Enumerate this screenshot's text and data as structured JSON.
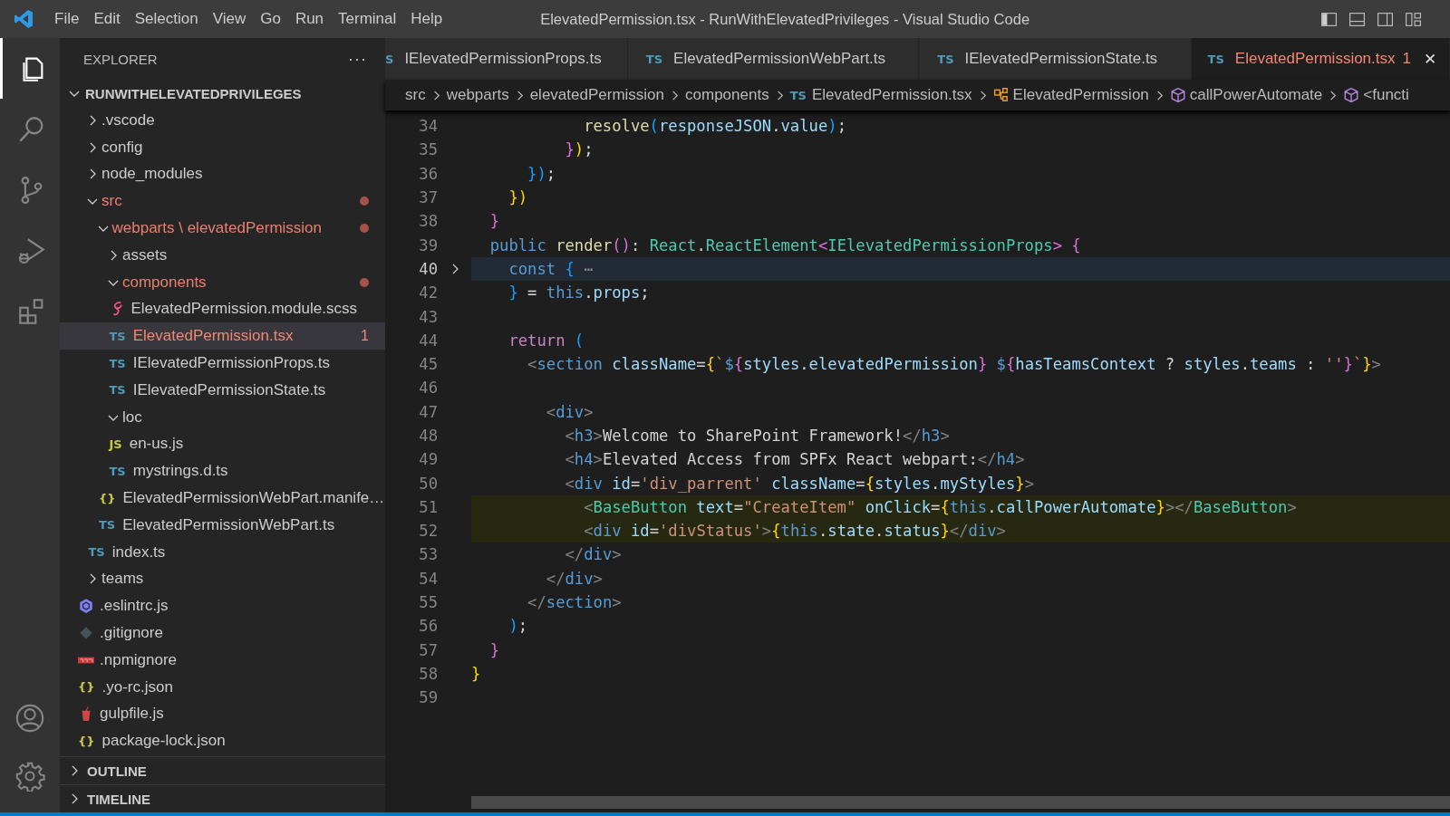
{
  "title_bar": {
    "menu": [
      "File",
      "Edit",
      "Selection",
      "View",
      "Go",
      "Run",
      "Terminal",
      "Help"
    ],
    "title": "ElevatedPermission.tsx - RunWithElevatedPrivileges - Visual Studio Code",
    "layout_buttons": [
      {
        "kind": "sidebar"
      },
      {
        "kind": "panel"
      },
      {
        "kind": "secondary"
      },
      {
        "kind": "customize"
      }
    ]
  },
  "activity_bar": {
    "items": [
      {
        "kind": "explorer",
        "selected": true
      },
      {
        "kind": "search",
        "selected": false
      },
      {
        "kind": "scm",
        "selected": false
      },
      {
        "kind": "debug",
        "selected": false
      },
      {
        "kind": "extensions",
        "selected": false
      }
    ],
    "bottom": [
      {
        "kind": "account"
      },
      {
        "kind": "settings"
      }
    ]
  },
  "explorer": {
    "title": "EXPLORER",
    "more": "···",
    "project": {
      "label": "RUNWITHELEVATEDPRIVILEGES",
      "expanded": true,
      "children": [
        {
          "kind": "folder",
          "label": ".vscode",
          "expanded": false,
          "selected": false,
          "modified": false,
          "error": false
        },
        {
          "kind": "folder",
          "label": "config",
          "expanded": false,
          "selected": false,
          "modified": false,
          "error": false
        },
        {
          "kind": "folder",
          "label": "node_modules",
          "expanded": false,
          "selected": false,
          "modified": false,
          "error": false
        },
        {
          "kind": "folder",
          "label": "src",
          "expanded": true,
          "selected": false,
          "modified": true,
          "error": false,
          "children": [
            {
              "kind": "folder",
              "label": "webparts \\ elevatedPermission",
              "expanded": true,
              "selected": false,
              "modified": true,
              "error": false,
              "children": [
                {
                  "kind": "folder",
                  "label": "assets",
                  "expanded": false,
                  "selected": false,
                  "modified": false,
                  "error": false
                },
                {
                  "kind": "folder",
                  "label": "components",
                  "expanded": true,
                  "selected": false,
                  "modified": true,
                  "error": false,
                  "children": [
                    {
                      "kind": "scss",
                      "label": "ElevatedPermission.module.scss",
                      "selected": false,
                      "modified": false,
                      "error": false
                    },
                    {
                      "kind": "ts",
                      "glyph": "TS",
                      "label": "ElevatedPermission.tsx",
                      "selected": true,
                      "modified": false,
                      "error": true,
                      "problems": "1"
                    },
                    {
                      "kind": "ts",
                      "glyph": "TS",
                      "label": "IElevatedPermissionProps.ts",
                      "selected": false,
                      "modified": false,
                      "error": false
                    },
                    {
                      "kind": "ts",
                      "glyph": "TS",
                      "label": "IElevatedPermissionState.ts",
                      "selected": false,
                      "modified": false,
                      "error": false
                    }
                  ]
                },
                {
                  "kind": "folder",
                  "label": "loc",
                  "expanded": true,
                  "selected": false,
                  "modified": false,
                  "error": false,
                  "children": [
                    {
                      "kind": "js",
                      "glyph": "JS",
                      "label": "en-us.js",
                      "selected": false,
                      "modified": false,
                      "error": false
                    },
                    {
                      "kind": "ts",
                      "glyph": "TS",
                      "label": "mystrings.d.ts",
                      "selected": false,
                      "modified": false,
                      "error": false
                    }
                  ]
                },
                {
                  "kind": "json",
                  "glyph": "{}",
                  "label": "ElevatedPermissionWebPart.manife…",
                  "selected": false,
                  "modified": false,
                  "error": false
                },
                {
                  "kind": "ts",
                  "glyph": "TS",
                  "label": "ElevatedPermissionWebPart.ts",
                  "selected": false,
                  "modified": false,
                  "error": false
                }
              ]
            },
            {
              "kind": "ts",
              "glyph": "TS",
              "label": "index.ts",
              "selected": false,
              "modified": false,
              "error": false
            }
          ]
        },
        {
          "kind": "folder",
          "label": "teams",
          "expanded": false,
          "selected": false,
          "modified": false,
          "error": false
        },
        {
          "kind": "eslint",
          "label": ".eslintrc.js",
          "selected": false,
          "modified": false,
          "error": false
        },
        {
          "kind": "git",
          "label": ".gitignore",
          "selected": false,
          "modified": false,
          "error": false
        },
        {
          "kind": "npm",
          "label": ".npmignore",
          "selected": false,
          "modified": false,
          "error": false
        },
        {
          "kind": "json",
          "glyph": "{}",
          "label": ".yo-rc.json",
          "selected": false,
          "modified": false,
          "error": false
        },
        {
          "kind": "gulp",
          "label": "gulpfile.js",
          "selected": false,
          "modified": false,
          "error": false
        },
        {
          "kind": "json",
          "glyph": "{}",
          "label": "package-lock.json",
          "selected": false,
          "modified": false,
          "error": false
        }
      ]
    },
    "sections": [
      {
        "label": "OUTLINE",
        "expanded": false
      },
      {
        "label": "TIMELINE",
        "expanded": false
      }
    ]
  },
  "tabs": [
    {
      "glyph": "S",
      "label": "IElevatedPermissionProps.ts",
      "selected": false,
      "error": false
    },
    {
      "glyph": "TS",
      "label": "ElevatedPermissionWebPart.ts",
      "selected": false,
      "error": false
    },
    {
      "glyph": "TS",
      "label": "IElevatedPermissionState.ts",
      "selected": false,
      "error": false
    },
    {
      "glyph": "TS",
      "label": "ElevatedPermission.tsx",
      "selected": true,
      "error": true,
      "problems": "1",
      "close": "✕"
    }
  ],
  "breadcrumbs": [
    {
      "kind": "folder",
      "label": "src"
    },
    {
      "kind": "folder",
      "label": "webparts"
    },
    {
      "kind": "folder",
      "label": "elevatedPermission"
    },
    {
      "kind": "folder",
      "label": "components"
    },
    {
      "kind": "file",
      "glyph": "TS",
      "label": "ElevatedPermission.tsx"
    },
    {
      "kind": "class",
      "label": "ElevatedPermission"
    },
    {
      "kind": "method",
      "label": "callPowerAutomate"
    },
    {
      "kind": "method",
      "label": "<functi"
    }
  ],
  "code": [
    {
      "n": "34",
      "fold": false,
      "current": false,
      "hl": false,
      "tokens": [
        {
          "t": "            resolve",
          "kind": "fn"
        },
        {
          "t": "(",
          "kind": "b3"
        },
        {
          "t": "responseJSON",
          "kind": "var"
        },
        {
          "t": ".",
          "kind": "plain"
        },
        {
          "t": "value",
          "kind": "var"
        },
        {
          "t": ")",
          "kind": "b3"
        },
        {
          "t": ";",
          "kind": "plain"
        }
      ]
    },
    {
      "n": "35",
      "fold": false,
      "current": false,
      "hl": false,
      "tokens": [
        {
          "t": "          }",
          "kind": "b2"
        },
        {
          "t": ")",
          "kind": "b1"
        },
        {
          "t": ";",
          "kind": "plain"
        }
      ]
    },
    {
      "n": "36",
      "fold": false,
      "current": false,
      "hl": false,
      "tokens": [
        {
          "t": "      })",
          "kind": "b3"
        },
        {
          "t": ";",
          "kind": "plain"
        }
      ]
    },
    {
      "n": "37",
      "fold": false,
      "current": false,
      "hl": false,
      "tokens": [
        {
          "t": "    })",
          "kind": "b1"
        }
      ]
    },
    {
      "n": "38",
      "fold": false,
      "current": false,
      "hl": false,
      "tokens": [
        {
          "t": "  }",
          "kind": "b2"
        }
      ]
    },
    {
      "n": "39",
      "fold": false,
      "current": false,
      "hl": false,
      "tokens": [
        {
          "t": "  public",
          "kind": "kw"
        },
        {
          "t": " render",
          "kind": "fn"
        },
        {
          "t": "()",
          "kind": "b2"
        },
        {
          "t": ": ",
          "kind": "plain"
        },
        {
          "t": "React",
          "kind": "type"
        },
        {
          "t": ".",
          "kind": "plain"
        },
        {
          "t": "ReactElement",
          "kind": "type"
        },
        {
          "t": "<",
          "kind": "b2"
        },
        {
          "t": "IElevatedPermissionProps",
          "kind": "type"
        },
        {
          "t": ">",
          "kind": "b2"
        },
        {
          "t": " {",
          "kind": "b2"
        }
      ]
    },
    {
      "n": "40",
      "fold": true,
      "current": true,
      "hl": false,
      "tokens": [
        {
          "t": "    const",
          "kind": "kw"
        },
        {
          "t": " {",
          "kind": "b3"
        },
        {
          "t": " ⋯",
          "kind": "dim"
        }
      ]
    },
    {
      "n": "42",
      "fold": false,
      "current": false,
      "hl": false,
      "tokens": [
        {
          "t": "    }",
          "kind": "b3"
        },
        {
          "t": " = ",
          "kind": "plain"
        },
        {
          "t": "this",
          "kind": "kw"
        },
        {
          "t": ".",
          "kind": "plain"
        },
        {
          "t": "props",
          "kind": "var"
        },
        {
          "t": ";",
          "kind": "plain"
        }
      ]
    },
    {
      "n": "43",
      "fold": false,
      "current": false,
      "hl": false
    },
    {
      "n": "44",
      "fold": false,
      "current": false,
      "hl": false,
      "tokens": [
        {
          "t": "    return",
          "kind": "ctl"
        },
        {
          "t": " (",
          "kind": "b3"
        }
      ]
    },
    {
      "n": "45",
      "fold": false,
      "current": false,
      "hl": false,
      "tokens": [
        {
          "t": "      <",
          "kind": "punct"
        },
        {
          "t": "section",
          "kind": "tag"
        },
        {
          "t": " className",
          "kind": "var"
        },
        {
          "t": "=",
          "kind": "plain"
        },
        {
          "t": "{",
          "kind": "b1"
        },
        {
          "t": "`",
          "kind": "str"
        },
        {
          "t": "$",
          "kind": "kw"
        },
        {
          "t": "{",
          "kind": "b2"
        },
        {
          "t": "styles",
          "kind": "var"
        },
        {
          "t": ".",
          "kind": "plain"
        },
        {
          "t": "elevatedPermission",
          "kind": "var"
        },
        {
          "t": "}",
          "kind": "b2"
        },
        {
          "t": " $",
          "kind": "kw"
        },
        {
          "t": "{",
          "kind": "b2"
        },
        {
          "t": "hasTeamsContext",
          "kind": "var"
        },
        {
          "t": " ? ",
          "kind": "plain"
        },
        {
          "t": "styles",
          "kind": "var"
        },
        {
          "t": ".",
          "kind": "plain"
        },
        {
          "t": "teams",
          "kind": "var"
        },
        {
          "t": " : ",
          "kind": "plain"
        },
        {
          "t": "''",
          "kind": "str"
        },
        {
          "t": "}",
          "kind": "b2"
        },
        {
          "t": "`",
          "kind": "str"
        },
        {
          "t": "}",
          "kind": "b1"
        },
        {
          "t": ">",
          "kind": "punct"
        }
      ]
    },
    {
      "n": "46",
      "fold": false,
      "current": false,
      "hl": false
    },
    {
      "n": "47",
      "fold": false,
      "current": false,
      "hl": false,
      "tokens": [
        {
          "t": "        <",
          "kind": "punct"
        },
        {
          "t": "div",
          "kind": "tag"
        },
        {
          "t": ">",
          "kind": "punct"
        }
      ]
    },
    {
      "n": "48",
      "fold": false,
      "current": false,
      "hl": false,
      "tokens": [
        {
          "t": "          <",
          "kind": "punct"
        },
        {
          "t": "h3",
          "kind": "tag"
        },
        {
          "t": ">",
          "kind": "punct"
        },
        {
          "t": "Welcome to SharePoint Framework!",
          "kind": "plain"
        },
        {
          "t": "</",
          "kind": "punct"
        },
        {
          "t": "h3",
          "kind": "tag"
        },
        {
          "t": ">",
          "kind": "punct"
        }
      ]
    },
    {
      "n": "49",
      "fold": false,
      "current": false,
      "hl": false,
      "tokens": [
        {
          "t": "          <",
          "kind": "punct"
        },
        {
          "t": "h4",
          "kind": "tag"
        },
        {
          "t": ">",
          "kind": "punct"
        },
        {
          "t": "Elevated Access from SPFx React webpart:",
          "kind": "plain"
        },
        {
          "t": "</",
          "kind": "punct"
        },
        {
          "t": "h4",
          "kind": "tag"
        },
        {
          "t": ">",
          "kind": "punct"
        }
      ]
    },
    {
      "n": "50",
      "fold": false,
      "current": false,
      "hl": false,
      "tokens": [
        {
          "t": "          <",
          "kind": "punct"
        },
        {
          "t": "div",
          "kind": "tag"
        },
        {
          "t": " id",
          "kind": "var"
        },
        {
          "t": "=",
          "kind": "plain"
        },
        {
          "t": "'div_parrent'",
          "kind": "str"
        },
        {
          "t": " className",
          "kind": "var"
        },
        {
          "t": "=",
          "kind": "plain"
        },
        {
          "t": "{",
          "kind": "b1"
        },
        {
          "t": "styles",
          "kind": "var"
        },
        {
          "t": ".",
          "kind": "plain"
        },
        {
          "t": "myStyles",
          "kind": "var"
        },
        {
          "t": "}",
          "kind": "b1"
        },
        {
          "t": ">",
          "kind": "punct"
        }
      ]
    },
    {
      "n": "51",
      "fold": false,
      "current": false,
      "hl": true,
      "tokens": [
        {
          "t": "            <",
          "kind": "punct"
        },
        {
          "t": "BaseButton",
          "kind": "type"
        },
        {
          "t": " text",
          "kind": "var"
        },
        {
          "t": "=",
          "kind": "plain"
        },
        {
          "t": "\"CreateItem\"",
          "kind": "str"
        },
        {
          "t": " onClick",
          "kind": "var"
        },
        {
          "t": "=",
          "kind": "plain"
        },
        {
          "t": "{",
          "kind": "b1"
        },
        {
          "t": "this",
          "kind": "kw"
        },
        {
          "t": ".",
          "kind": "plain"
        },
        {
          "t": "callPowerAutomate",
          "kind": "var"
        },
        {
          "t": "}",
          "kind": "b1"
        },
        {
          "t": "></",
          "kind": "punct"
        },
        {
          "t": "BaseButton",
          "kind": "type"
        },
        {
          "t": ">",
          "kind": "punct"
        }
      ]
    },
    {
      "n": "52",
      "fold": false,
      "current": false,
      "hl": true,
      "tokens": [
        {
          "t": "            <",
          "kind": "punct"
        },
        {
          "t": "div",
          "kind": "tag"
        },
        {
          "t": " id",
          "kind": "var"
        },
        {
          "t": "=",
          "kind": "plain"
        },
        {
          "t": "'divStatus'",
          "kind": "str"
        },
        {
          "t": ">",
          "kind": "punct"
        },
        {
          "t": "{",
          "kind": "b1"
        },
        {
          "t": "this",
          "kind": "kw"
        },
        {
          "t": ".",
          "kind": "plain"
        },
        {
          "t": "state",
          "kind": "var"
        },
        {
          "t": ".",
          "kind": "plain"
        },
        {
          "t": "status",
          "kind": "var"
        },
        {
          "t": "}",
          "kind": "b1"
        },
        {
          "t": "</",
          "kind": "punct"
        },
        {
          "t": "div",
          "kind": "tag"
        },
        {
          "t": ">",
          "kind": "punct"
        }
      ]
    },
    {
      "n": "53",
      "fold": false,
      "current": false,
      "hl": false,
      "tokens": [
        {
          "t": "          </",
          "kind": "punct"
        },
        {
          "t": "div",
          "kind": "tag"
        },
        {
          "t": ">",
          "kind": "punct"
        }
      ]
    },
    {
      "n": "54",
      "fold": false,
      "current": false,
      "hl": false,
      "tokens": [
        {
          "t": "        </",
          "kind": "punct"
        },
        {
          "t": "div",
          "kind": "tag"
        },
        {
          "t": ">",
          "kind": "punct"
        }
      ]
    },
    {
      "n": "55",
      "fold": false,
      "current": false,
      "hl": false,
      "tokens": [
        {
          "t": "      </",
          "kind": "punct"
        },
        {
          "t": "section",
          "kind": "tag"
        },
        {
          "t": ">",
          "kind": "punct"
        }
      ]
    },
    {
      "n": "56",
      "fold": false,
      "current": false,
      "hl": false,
      "tokens": [
        {
          "t": "    )",
          "kind": "b3"
        },
        {
          "t": ";",
          "kind": "plain"
        }
      ]
    },
    {
      "n": "57",
      "fold": false,
      "current": false,
      "hl": false,
      "tokens": [
        {
          "t": "  }",
          "kind": "b2"
        }
      ]
    },
    {
      "n": "58",
      "fold": false,
      "current": false,
      "hl": false,
      "tokens": [
        {
          "t": "}",
          "kind": "b1"
        }
      ]
    },
    {
      "n": "59",
      "fold": false,
      "current": false,
      "hl": false
    }
  ]
}
